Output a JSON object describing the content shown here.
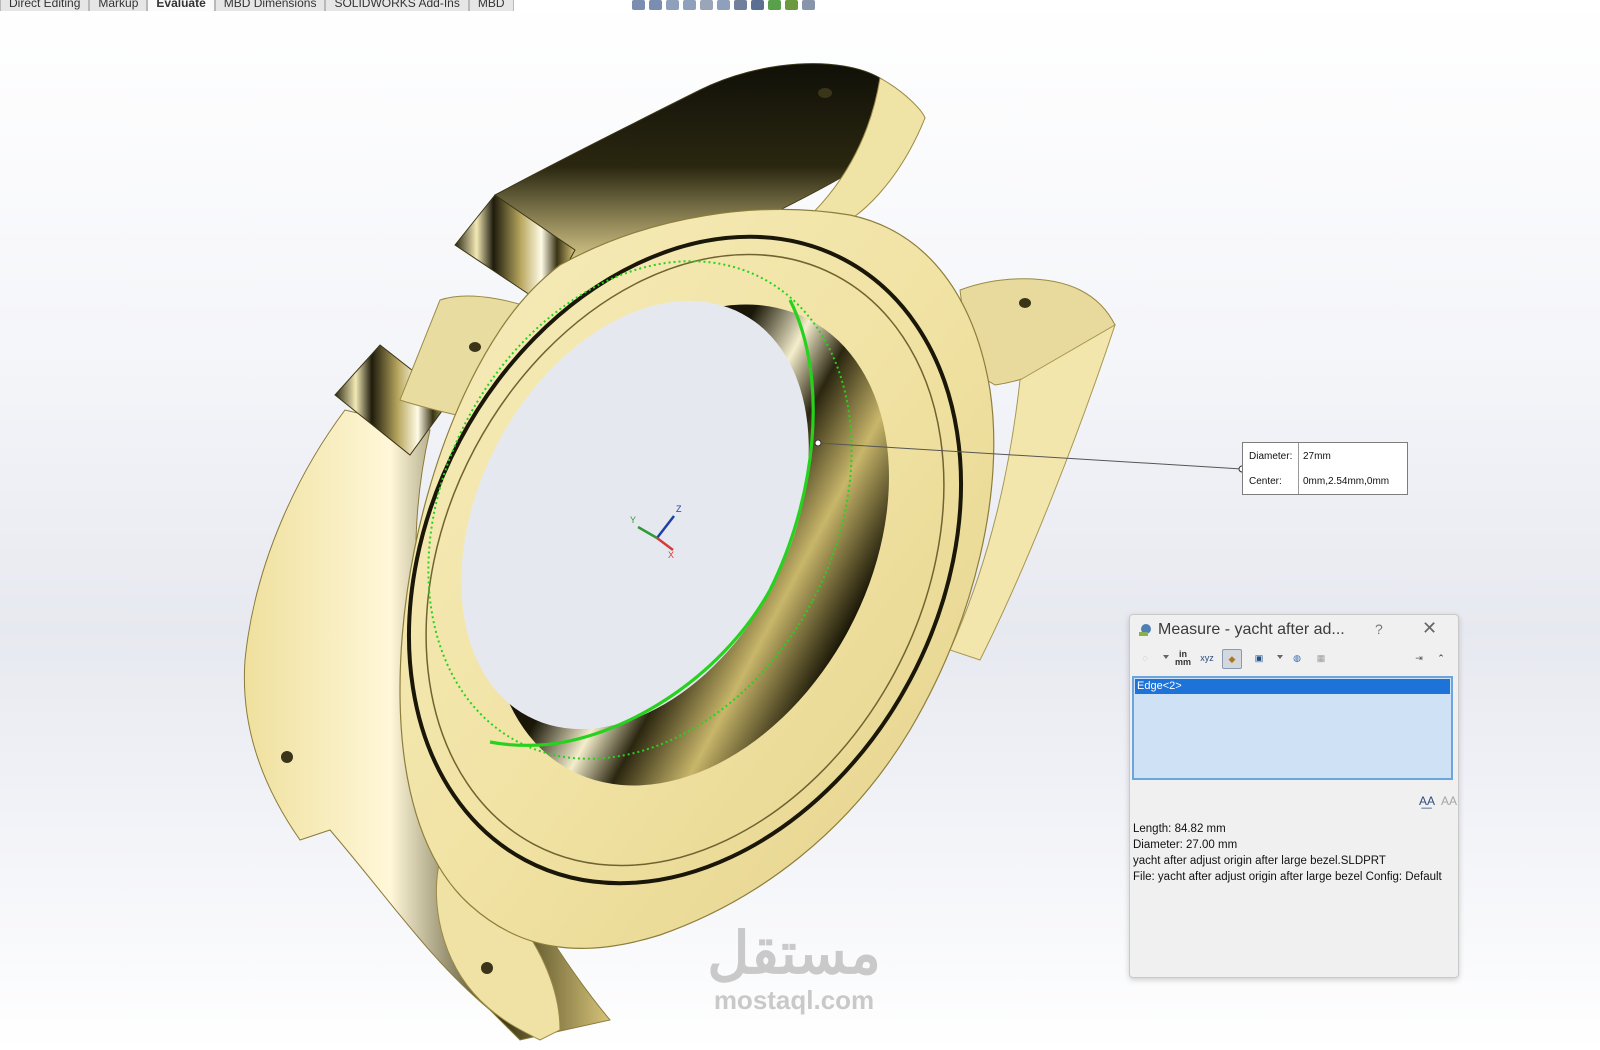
{
  "ribbon": {
    "tabs": [
      "Direct Editing",
      "Markup",
      "Evaluate",
      "MBD Dimensions",
      "SOLIDWORKS Add-Ins",
      "MBD"
    ],
    "active_tab": "Evaluate"
  },
  "triad": {
    "x": "X",
    "y": "Y",
    "z": "Z"
  },
  "callout": {
    "diameter_label": "Diameter:",
    "diameter_value": "27mm",
    "center_label": "Center:",
    "center_value": "0mm,2.54mm,0mm"
  },
  "measure_dialog": {
    "title": "Measure - yacht after ad...",
    "help": "?",
    "toolbar_icons": [
      "arc-circle-options-icon",
      "units-in-mm-icon",
      "show-xyz-icon",
      "point-to-point-icon",
      "projected-on-icon",
      "measurement-history-icon",
      "create-sensor-icon",
      "pin-icon",
      "collapse-icon"
    ],
    "units_label_top": "in",
    "units_label_bottom": "mm",
    "selections": [
      "Edge<2>"
    ],
    "results": [
      "Length: 84.82 mm",
      "Diameter: 27.00 mm",
      "yacht after adjust origin after large bezel.SLDPRT",
      "File: yacht after adjust origin after large bezel Config: Default"
    ]
  },
  "watermark": {
    "arabic": "مستقل",
    "latin": "mostaql.com"
  },
  "colors": {
    "gold": "#f1e3a4",
    "gold_shadow": "#cfc07a",
    "selection_green": "#27d21f",
    "selection_blue": "#1e73d8"
  }
}
